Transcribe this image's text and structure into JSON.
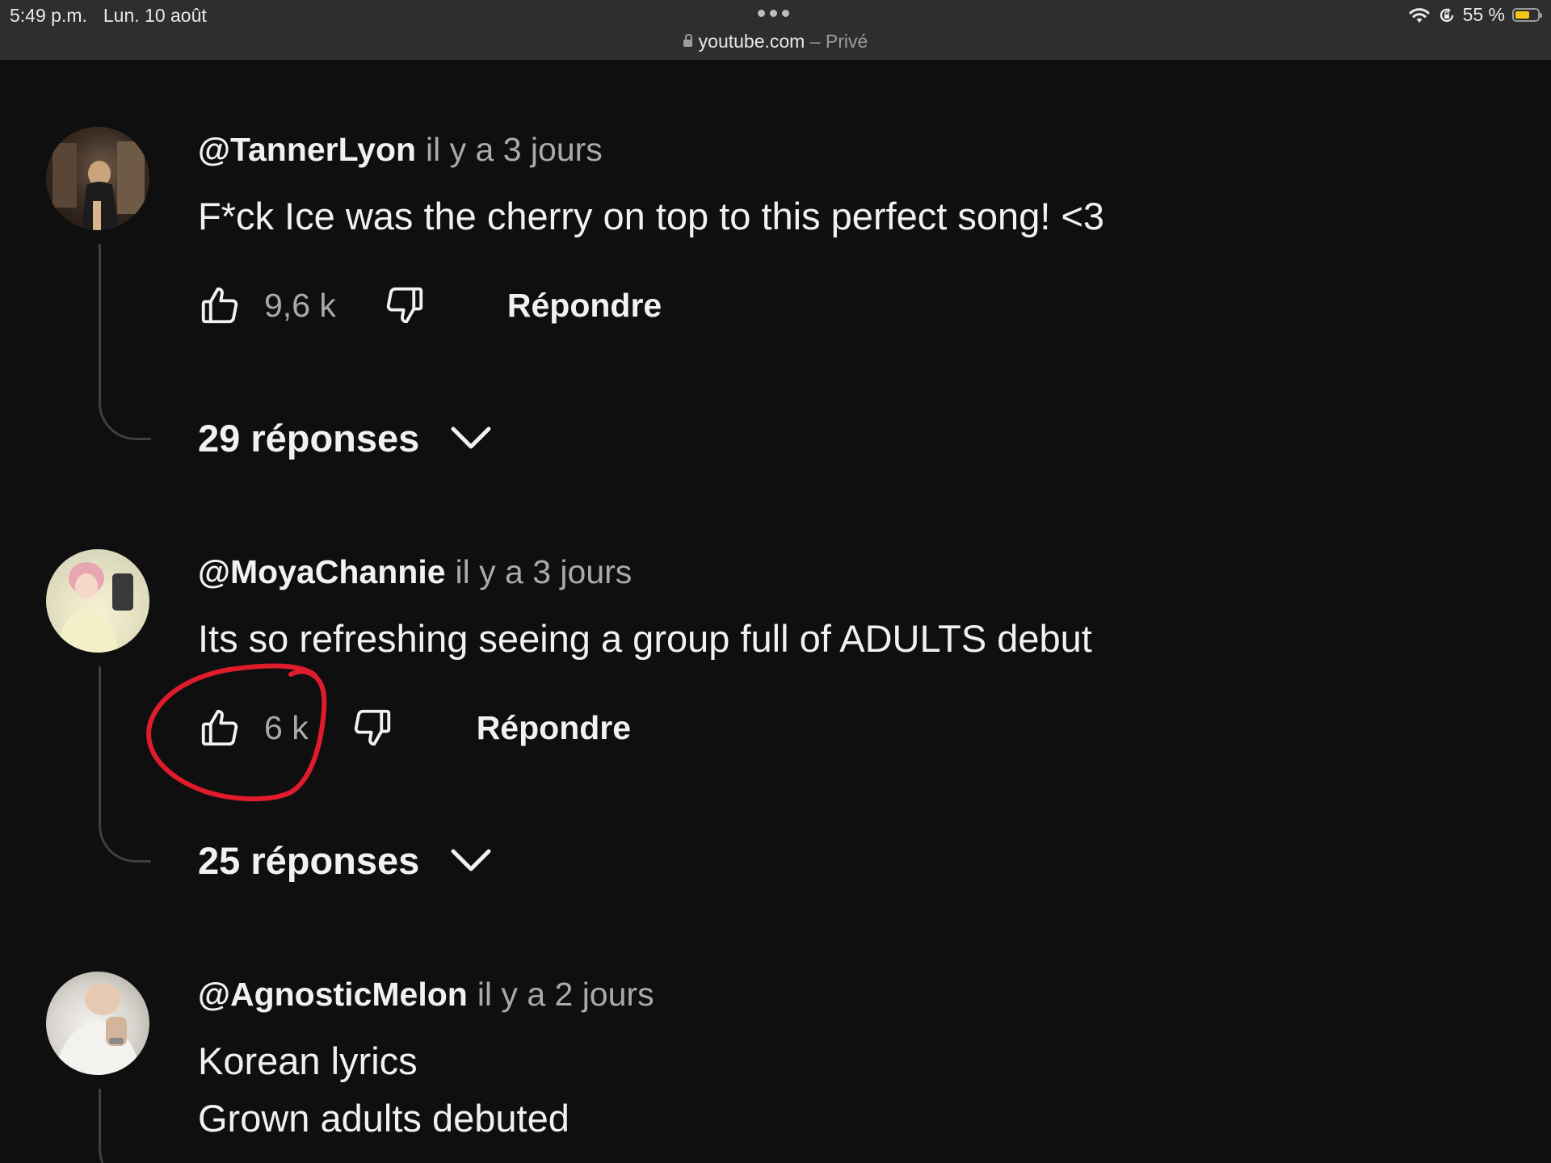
{
  "status_bar": {
    "time": "5:49 p.m.",
    "date": "Lun. 10 août",
    "url": "youtube.com",
    "url_suffix": " – Privé",
    "battery": "55 %",
    "battery_level": 0.55,
    "icons": [
      "wifi-icon",
      "rotation-lock-icon",
      "battery-icon"
    ]
  },
  "reply_label": "Répondre",
  "comments": [
    {
      "author": "@TannerLyon",
      "time": "il y a 3 jours",
      "lines": [
        "F*ck Ice was the cherry on top to this perfect song! <3"
      ],
      "likes": "9,6 k",
      "replies": "29 réponses"
    },
    {
      "author": "@MoyaChannie",
      "time": "il y a 3 jours",
      "lines": [
        "Its so refreshing seeing a group full of ADULTS  debut"
      ],
      "likes": "6 k",
      "replies": "25 réponses",
      "highlight_color": "#e01b2b"
    },
    {
      "author": "@AgnosticMelon",
      "time": "il y a 2 jours",
      "lines": [
        "Korean lyrics",
        "Grown adults debuted"
      ]
    }
  ],
  "colors": {
    "background": "#0f0f0f",
    "status_bar": "#2e2e2e",
    "secondary_text": "#aaaaaa",
    "annotation": "#e01b2b"
  }
}
